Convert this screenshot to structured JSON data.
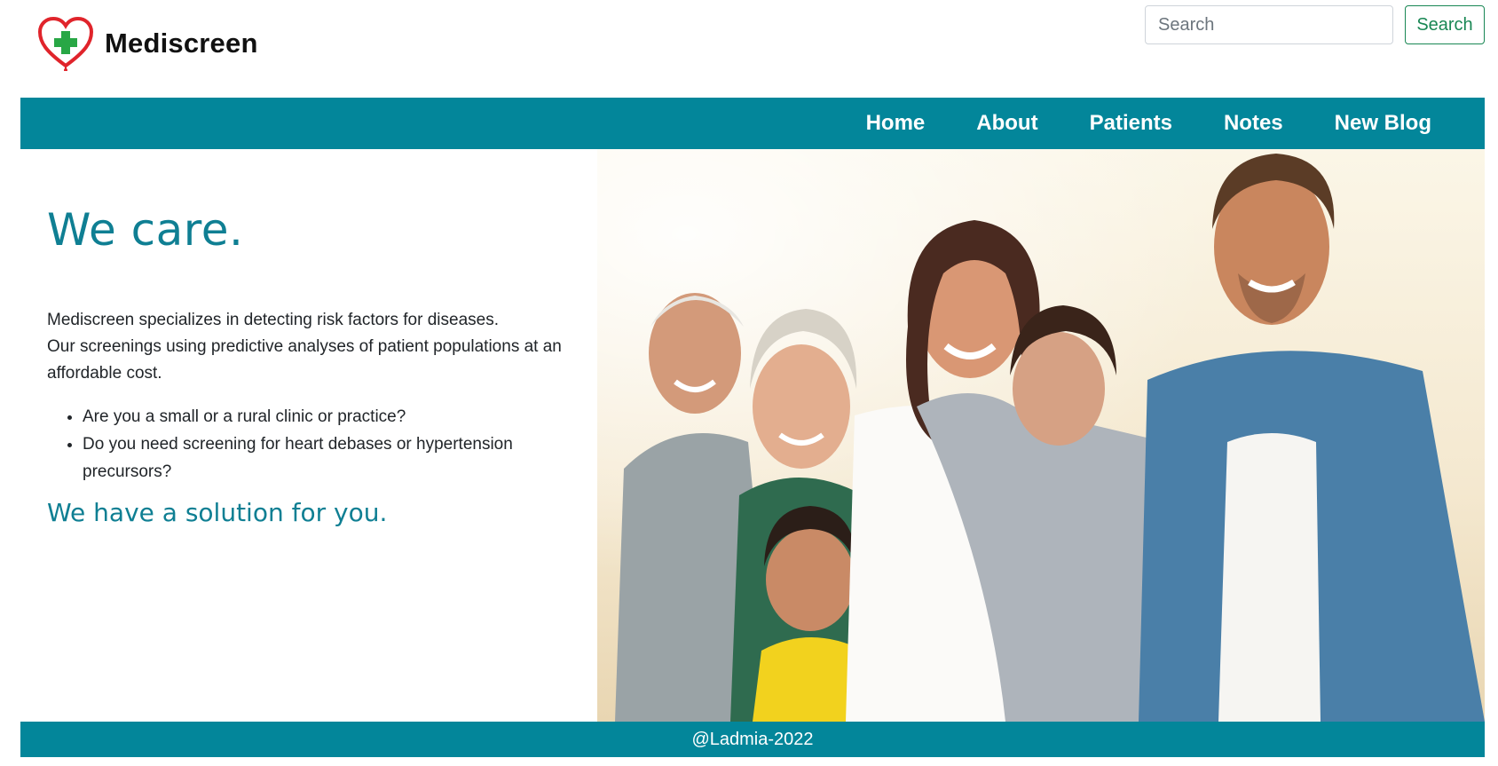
{
  "brand": {
    "name": "Mediscreen",
    "logo_icon": "heart-cross-icon",
    "colors": {
      "heart": "#e0242b",
      "cross": "#28a745"
    }
  },
  "search": {
    "placeholder": "Search",
    "button_label": "Search",
    "accent": "#198754"
  },
  "nav": {
    "background": "#03869a",
    "items": [
      {
        "label": "Home"
      },
      {
        "label": "About"
      },
      {
        "label": "Patients"
      },
      {
        "label": "Notes"
      },
      {
        "label": "New Blog"
      }
    ]
  },
  "hero": {
    "headline": "We care.",
    "description_lines": [
      "Mediscreen specializes in detecting risk factors for diseases.",
      "Our screenings using predictive analyses of patient populations at an affordable cost."
    ],
    "bullets": [
      "Are you a small or a rural clinic or practice?",
      "Do you need screening for heart debases or hypertension precursors?"
    ],
    "tagline": "We have a solution for you.",
    "accent": "#0f7f93",
    "image_icon": "family-photo"
  },
  "footer": {
    "text": "@Ladmia-2022",
    "background": "#03869a"
  }
}
